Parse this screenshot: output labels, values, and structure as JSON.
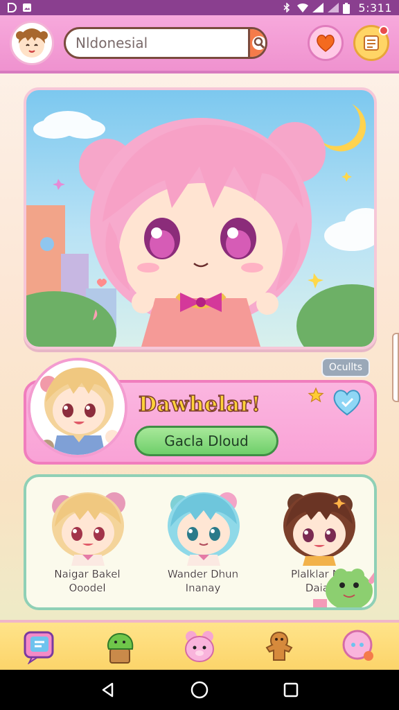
{
  "status_bar": {
    "time": "5:311",
    "icons": [
      "notification-d-icon",
      "image-icon",
      "bluetooth-icon",
      "wifi-icon",
      "signal-icon",
      "signal-icon",
      "battery-icon"
    ]
  },
  "app_bar": {
    "search": {
      "value": "Nldonesial",
      "placeholder": ""
    },
    "icons": {
      "avatar": "avatar-icon",
      "search_button": "search-icon",
      "heart_button": "heart-icon",
      "note_button": "note-icon"
    }
  },
  "hero": {
    "badge": "Ocullts"
  },
  "welcome": {
    "title": "Dawhelar!",
    "button_label": "Gacla Dloud"
  },
  "friends": [
    {
      "name": "Naigar Bakel\nOoodel"
    },
    {
      "name": "Wander Dhun\nInanay"
    },
    {
      "name": "Plalklar No\nDaial"
    }
  ],
  "bottom_nav": [
    "chat-icon",
    "plant-icon",
    "bear-icon",
    "gingerbread-icon",
    "bubble-icon"
  ],
  "system_nav": [
    "back-icon",
    "home-icon",
    "recents-icon"
  ],
  "colors": {
    "status_bar": "#8a3f8f",
    "app_bar": "#f7a9dc",
    "accent_orange": "#f47b4a",
    "welcome_card": "#fbb6e0",
    "button_green": "#6fcf6a",
    "nav_yellow": "#ffe48a"
  }
}
